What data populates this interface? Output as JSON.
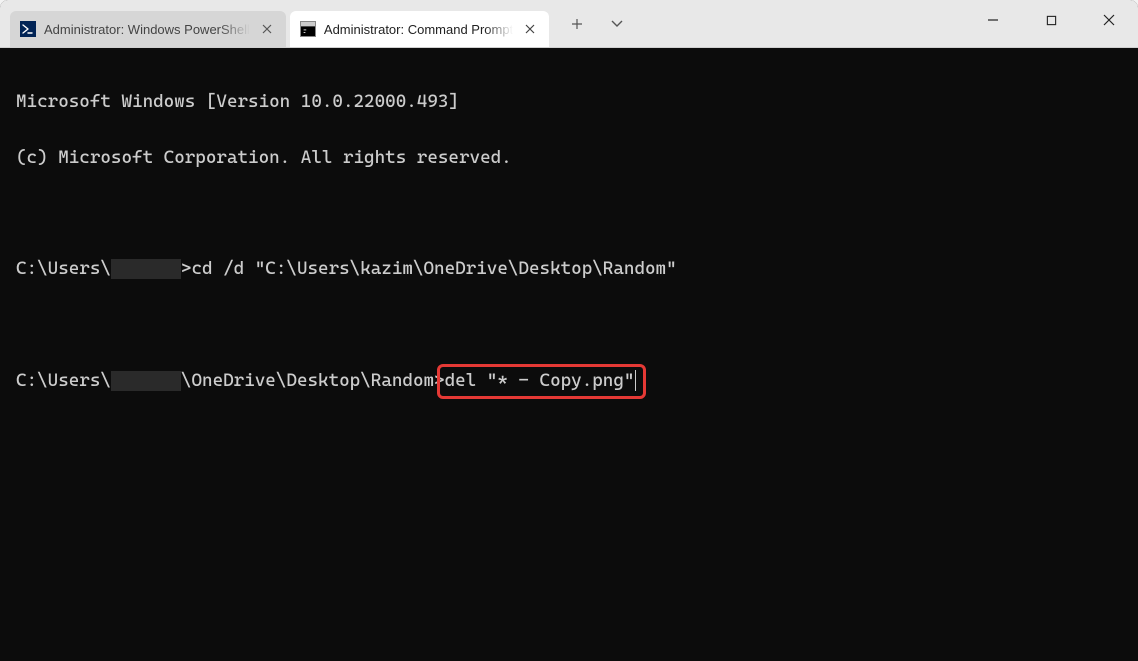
{
  "tabs": [
    {
      "title": "Administrator: Windows PowerShell",
      "icon": "powershell-icon"
    },
    {
      "title": "Administrator: Command Prompt",
      "icon": "cmd-icon"
    }
  ],
  "terminal": {
    "line1": "Microsoft Windows [Version 10.0.22000.493]",
    "line2": "(c) Microsoft Corporation. All rights reserved.",
    "prompt1_pre": "C:\\Users\\",
    "prompt1_post": ">",
    "cmd1": "cd /d \"C:\\Users\\kazim\\OneDrive\\Desktop\\Random\"",
    "prompt2_pre": "C:\\Users\\",
    "prompt2_mid": "\\OneDrive\\Desktop\\Random>",
    "cmd2": "del \"* - Copy.png\""
  },
  "highlight": {
    "target": "cmd2"
  }
}
